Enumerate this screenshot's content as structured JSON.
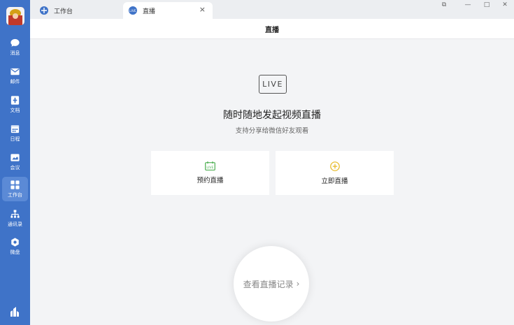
{
  "sidebar": {
    "items": [
      {
        "label": "消息",
        "icon": "chat-icon"
      },
      {
        "label": "邮件",
        "icon": "mail-icon"
      },
      {
        "label": "文档",
        "icon": "document-icon"
      },
      {
        "label": "日程",
        "icon": "calendar-icon"
      },
      {
        "label": "会议",
        "icon": "meeting-icon"
      },
      {
        "label": "工作台",
        "icon": "workbench-icon",
        "active": true
      },
      {
        "label": "通讯录",
        "icon": "contacts-icon"
      },
      {
        "label": "微盘",
        "icon": "drive-icon"
      }
    ],
    "bottom_icon": "app-logo-icon"
  },
  "tabs": [
    {
      "label": "工作台",
      "icon": "workbench-tab-icon"
    },
    {
      "label": "直播",
      "icon": "live-tab-icon",
      "active": true,
      "close": "×"
    }
  ],
  "window_controls": {
    "restore": "⧉",
    "minimize": "—",
    "maximize": "□",
    "close": "✕"
  },
  "header": {
    "title": "直播"
  },
  "main": {
    "badge": "LIVE",
    "title": "随时随地发起视频直播",
    "subtitle": "支持分享给微信好友观看",
    "cards": [
      {
        "label": "预约直播",
        "icon": "schedule-live-icon"
      },
      {
        "label": "立即直播",
        "icon": "add-circle-icon"
      }
    ],
    "history_button": {
      "label": "查看直播记录",
      "chevron": "›"
    }
  },
  "colors": {
    "sidebar": "#3f73c8",
    "sidebar_active": "#5b8ad6",
    "schedule_icon": "#4caf50",
    "start_icon": "#e6b820"
  }
}
